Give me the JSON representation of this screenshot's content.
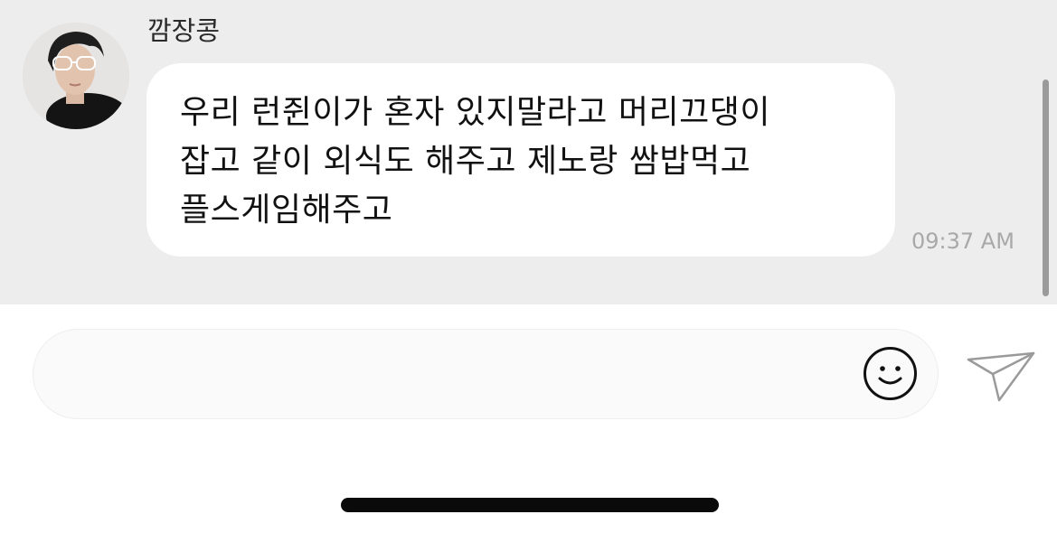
{
  "message": {
    "sender_name": "깜장콩",
    "text": "우리 런쥔이가 혼자 있지말라고 머리끄댕이\n잡고 같이 외식도 해주고 제노랑 쌈밥먹고\n플스게임해주고",
    "timestamp": "09:37 AM"
  },
  "composer": {
    "placeholder": "",
    "emoji_icon": "smiley-icon",
    "send_icon": "paper-plane-icon"
  },
  "colors": {
    "chat_background": "#ededed",
    "bubble": "#ffffff",
    "timestamp": "#a8a8a8",
    "icon_stroke": "#9a9a9a"
  }
}
